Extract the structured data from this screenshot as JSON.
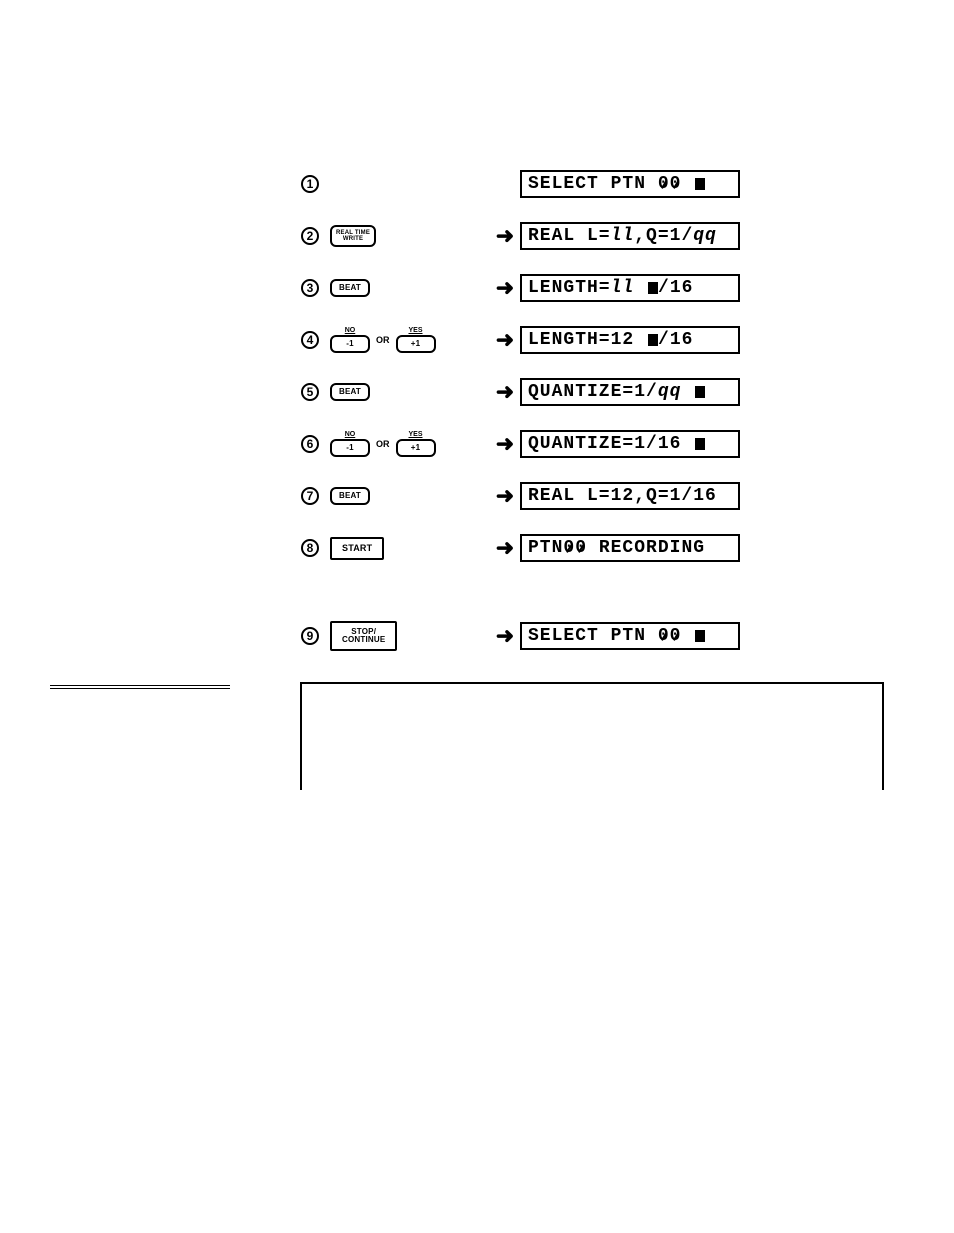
{
  "steps": [
    {
      "num": 1,
      "buttons": [],
      "arrow": false,
      "lcd": {
        "parts": [
          {
            "t": "SELECT PTN "
          },
          {
            "t": "0",
            "zero": true
          },
          {
            "t": "0",
            "zero": true
          },
          {
            "t": " "
          },
          {
            "cursor": true
          }
        ]
      }
    },
    {
      "num": 2,
      "buttons": [
        {
          "kind": "realtime",
          "top": "REAL TIME",
          "bot": "WRITE"
        }
      ],
      "arrow": true,
      "lcd": {
        "parts": [
          {
            "t": "REAL L="
          },
          {
            "t": "ll",
            "ital": true
          },
          {
            "t": ",Q=1/"
          },
          {
            "t": "qq",
            "ital": true
          }
        ]
      }
    },
    {
      "num": 3,
      "buttons": [
        {
          "kind": "pill",
          "label": "BEAT"
        }
      ],
      "arrow": true,
      "lcd": {
        "parts": [
          {
            "t": "LENGTH="
          },
          {
            "t": "ll",
            "ital": true
          },
          {
            "t": " "
          },
          {
            "cursor": true
          },
          {
            "t": "/16"
          }
        ]
      }
    },
    {
      "num": 4,
      "buttons": [
        {
          "kind": "labeled",
          "top": "NO",
          "label": "-1"
        },
        {
          "kind": "or"
        },
        {
          "kind": "labeled",
          "top": "YES",
          "label": "+1"
        }
      ],
      "arrow": true,
      "lcd": {
        "parts": [
          {
            "t": "LENGTH=12 "
          },
          {
            "cursor": true
          },
          {
            "t": "/16"
          }
        ]
      }
    },
    {
      "num": 5,
      "buttons": [
        {
          "kind": "pill",
          "label": "BEAT"
        }
      ],
      "arrow": true,
      "lcd": {
        "parts": [
          {
            "t": "QUANTIZE=1/"
          },
          {
            "t": "qq",
            "ital": true
          },
          {
            "t": " "
          },
          {
            "cursor": true
          }
        ]
      }
    },
    {
      "num": 6,
      "buttons": [
        {
          "kind": "labeled",
          "top": "NO",
          "label": "-1"
        },
        {
          "kind": "or"
        },
        {
          "kind": "labeled",
          "top": "YES",
          "label": "+1"
        }
      ],
      "arrow": true,
      "lcd": {
        "parts": [
          {
            "t": "QUANTIZE=1/16 "
          },
          {
            "cursor": true
          }
        ]
      }
    },
    {
      "num": 7,
      "buttons": [
        {
          "kind": "pill",
          "label": "BEAT"
        }
      ],
      "arrow": true,
      "lcd": {
        "parts": [
          {
            "t": "REAL L=12,Q=1/16"
          }
        ]
      }
    },
    {
      "num": 8,
      "buttons": [
        {
          "kind": "rect",
          "label": "START"
        }
      ],
      "arrow": true,
      "lcd": {
        "parts": [
          {
            "t": "PTN"
          },
          {
            "t": "0",
            "zero": true
          },
          {
            "t": "0",
            "zero": true
          },
          {
            "t": " RECORDING"
          }
        ]
      }
    },
    {
      "gap": true
    },
    {
      "num": 9,
      "buttons": [
        {
          "kind": "rect",
          "label2": [
            "STOP/",
            "CONTINUE"
          ]
        }
      ],
      "arrow": true,
      "lcd": {
        "parts": [
          {
            "t": "SELECT PTN "
          },
          {
            "t": "0",
            "zero": true
          },
          {
            "t": "0",
            "zero": true
          },
          {
            "t": " "
          },
          {
            "cursor": true
          }
        ]
      }
    }
  ],
  "labels": {
    "or": "OR"
  }
}
